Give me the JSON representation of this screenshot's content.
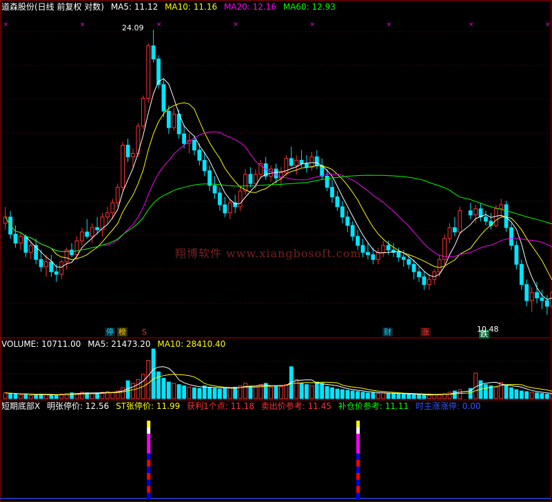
{
  "header_main": {
    "name": "道森股份(日线 前复权 对数)",
    "ma5": "MA5: 11.12",
    "ma10": "MA10: 11.16",
    "ma20": "MA20: 12.16",
    "ma60": "MA60: 12.93"
  },
  "header_volume": {
    "vol": "VOLUME: 10711.00",
    "ma5": "MA5: 21473.20",
    "ma10": "MA10: 28410.40"
  },
  "header_indicator": {
    "title": "短期底部X",
    "ming": "明张停价: 12.56",
    "st": "ST张停价: 11.99",
    "profit": "获利1个点: 11.18",
    "sell": "卖出价参考: 11.45",
    "buy": "补仓价参考: 11.11",
    "boss": "时主涨涨停: 0.00"
  },
  "watermark": "翔博软件 www.xiangbosoft.com",
  "annotations": {
    "high_label": "24.09",
    "low_label": "10.48",
    "badge_ting": "停",
    "badge_bang": "榜",
    "badge_s": "S",
    "badge_cai": "财",
    "badge_zhang": "涨",
    "badge_die": "跌"
  },
  "colors": {
    "up": "#ff3333",
    "down": "#00e5ff",
    "ma5": "#ffffff",
    "ma10": "#ffff00",
    "ma20": "#ff00ff",
    "ma60": "#00ff00"
  },
  "chart_data": {
    "type": "candlestick",
    "scale": "log",
    "price_range": [
      9.8,
      27.0
    ],
    "candles": [
      [
        14.0,
        14.8,
        13.7,
        14.3
      ],
      [
        14.3,
        14.6,
        13.3,
        13.5
      ],
      [
        13.5,
        13.9,
        12.9,
        13.1
      ],
      [
        13.1,
        13.6,
        12.8,
        13.4
      ],
      [
        13.4,
        13.5,
        12.5,
        12.7
      ],
      [
        12.7,
        13.2,
        12.4,
        13.0
      ],
      [
        13.0,
        13.3,
        12.2,
        12.4
      ],
      [
        12.4,
        12.8,
        11.9,
        12.1
      ],
      [
        12.1,
        12.6,
        11.7,
        12.3
      ],
      [
        12.3,
        12.6,
        11.7,
        11.9
      ],
      [
        11.9,
        12.2,
        11.5,
        11.8
      ],
      [
        11.8,
        12.4,
        11.6,
        12.3
      ],
      [
        12.3,
        12.9,
        12.0,
        12.8
      ],
      [
        12.8,
        13.1,
        12.5,
        12.6
      ],
      [
        12.6,
        13.4,
        12.4,
        13.2
      ],
      [
        13.2,
        13.8,
        13.0,
        13.6
      ],
      [
        13.6,
        14.2,
        13.3,
        13.4
      ],
      [
        13.4,
        14.0,
        13.1,
        13.8
      ],
      [
        13.8,
        14.3,
        13.5,
        13.7
      ],
      [
        13.7,
        14.5,
        13.4,
        14.3
      ],
      [
        14.3,
        14.8,
        14.0,
        14.5
      ],
      [
        14.5,
        15.2,
        14.2,
        15.0
      ],
      [
        15.0,
        16.0,
        14.8,
        15.8
      ],
      [
        15.8,
        18.4,
        15.6,
        18.2
      ],
      [
        18.2,
        18.6,
        17.2,
        17.5
      ],
      [
        17.5,
        18.0,
        16.9,
        17.7
      ],
      [
        17.7,
        19.6,
        17.5,
        19.4
      ],
      [
        19.4,
        21.5,
        19.2,
        21.3
      ],
      [
        21.3,
        25.6,
        21.0,
        25.4
      ],
      [
        25.4,
        26.8,
        24.0,
        24.3
      ],
      [
        24.3,
        24.6,
        22.0,
        22.3
      ],
      [
        22.3,
        22.8,
        20.0,
        20.4
      ],
      [
        20.4,
        20.8,
        18.9,
        19.3
      ],
      [
        19.3,
        20.6,
        19.1,
        20.2
      ],
      [
        20.2,
        20.5,
        18.6,
        18.9
      ],
      [
        18.9,
        19.5,
        18.0,
        18.3
      ],
      [
        18.3,
        18.9,
        17.7,
        18.5
      ],
      [
        18.5,
        18.8,
        17.6,
        17.9
      ],
      [
        17.9,
        18.3,
        17.0,
        17.3
      ],
      [
        17.3,
        17.8,
        16.4,
        16.7
      ],
      [
        16.7,
        17.0,
        15.6,
        15.9
      ],
      [
        15.9,
        16.4,
        15.2,
        15.5
      ],
      [
        15.5,
        15.8,
        14.6,
        14.9
      ],
      [
        14.9,
        15.3,
        14.3,
        14.5
      ],
      [
        14.5,
        15.2,
        14.2,
        15.0
      ],
      [
        15.0,
        15.4,
        14.5,
        14.8
      ],
      [
        14.8,
        15.9,
        14.6,
        15.6
      ],
      [
        15.6,
        16.8,
        15.4,
        16.5
      ],
      [
        16.5,
        16.9,
        15.8,
        16.0
      ],
      [
        16.0,
        16.8,
        15.7,
        16.5
      ],
      [
        16.5,
        17.3,
        16.3,
        17.1
      ],
      [
        17.1,
        17.5,
        16.2,
        16.4
      ],
      [
        16.4,
        17.0,
        16.1,
        16.8
      ],
      [
        16.8,
        17.1,
        16.0,
        16.3
      ],
      [
        16.3,
        16.9,
        15.8,
        16.6
      ],
      [
        16.6,
        17.6,
        16.4,
        17.4
      ],
      [
        17.4,
        18.1,
        16.9,
        17.0
      ],
      [
        17.0,
        17.6,
        16.5,
        17.3
      ],
      [
        17.3,
        17.9,
        16.9,
        17.1
      ],
      [
        17.1,
        17.6,
        16.6,
        16.9
      ],
      [
        16.9,
        17.8,
        16.7,
        17.5
      ],
      [
        17.5,
        17.9,
        16.8,
        17.0
      ],
      [
        17.0,
        17.4,
        16.2,
        16.4
      ],
      [
        16.4,
        16.8,
        15.6,
        15.8
      ],
      [
        15.8,
        16.2,
        15.0,
        15.3
      ],
      [
        15.3,
        15.6,
        14.6,
        14.8
      ],
      [
        14.8,
        15.1,
        14.0,
        14.3
      ],
      [
        14.3,
        14.6,
        13.6,
        13.9
      ],
      [
        13.9,
        14.1,
        13.2,
        13.4
      ],
      [
        13.4,
        13.7,
        12.8,
        13.0
      ],
      [
        13.0,
        13.3,
        12.5,
        12.7
      ],
      [
        12.7,
        13.1,
        12.4,
        12.6
      ],
      [
        12.6,
        12.9,
        12.2,
        12.4
      ],
      [
        12.4,
        12.9,
        12.2,
        12.7
      ],
      [
        12.7,
        13.2,
        12.5,
        13.0
      ],
      [
        13.0,
        13.2,
        12.6,
        12.8
      ],
      [
        12.8,
        13.1,
        12.5,
        12.7
      ],
      [
        12.7,
        12.9,
        12.3,
        12.5
      ],
      [
        12.5,
        12.8,
        12.1,
        12.4
      ],
      [
        12.4,
        12.6,
        12.0,
        12.2
      ],
      [
        12.2,
        12.4,
        11.6,
        11.9
      ],
      [
        11.9,
        12.1,
        11.5,
        11.7
      ],
      [
        11.7,
        11.9,
        11.2,
        11.4
      ],
      [
        11.4,
        11.8,
        11.2,
        11.6
      ],
      [
        11.6,
        12.0,
        11.4,
        11.9
      ],
      [
        11.9,
        12.6,
        11.7,
        12.4
      ],
      [
        12.4,
        13.5,
        12.2,
        13.3
      ],
      [
        13.3,
        14.0,
        13.1,
        13.8
      ],
      [
        13.8,
        14.3,
        13.4,
        13.6
      ],
      [
        13.6,
        14.8,
        13.5,
        14.6
      ],
      [
        14.6,
        15.0,
        14.2,
        14.4
      ],
      [
        14.4,
        14.9,
        14.0,
        14.7
      ],
      [
        14.7,
        15.0,
        14.1,
        14.3
      ],
      [
        14.3,
        14.6,
        13.9,
        14.1
      ],
      [
        14.1,
        14.5,
        13.7,
        13.9
      ],
      [
        13.9,
        14.9,
        13.8,
        14.7
      ],
      [
        14.7,
        15.2,
        14.3,
        14.9
      ],
      [
        14.9,
        15.1,
        13.6,
        13.8
      ],
      [
        13.8,
        14.0,
        12.8,
        13.0
      ],
      [
        13.0,
        13.2,
        12.0,
        12.2
      ],
      [
        12.2,
        12.4,
        11.2,
        11.4
      ],
      [
        11.4,
        11.6,
        10.6,
        10.8
      ],
      [
        10.8,
        11.3,
        10.4,
        11.1
      ],
      [
        11.1,
        11.5,
        10.7,
        10.9
      ],
      [
        10.9,
        11.2,
        10.5,
        10.8
      ],
      [
        10.8,
        11.0,
        10.3,
        10.6
      ],
      [
        10.6,
        11.2,
        10.5,
        11.1
      ]
    ],
    "gap_at": 90,
    "volume": [
      9,
      8,
      7,
      6,
      7,
      5,
      6,
      7,
      6,
      5,
      6,
      7,
      8,
      9,
      8,
      10,
      9,
      8,
      9,
      10,
      11,
      10,
      12,
      17,
      28,
      24,
      30,
      38,
      60,
      78,
      42,
      32,
      26,
      24,
      22,
      20,
      18,
      17,
      16,
      20,
      18,
      16,
      15,
      16,
      17,
      18,
      20,
      24,
      19,
      18,
      22,
      24,
      18,
      20,
      19,
      22,
      50,
      30,
      24,
      22,
      20,
      26,
      24,
      19,
      17,
      15,
      14,
      13,
      12,
      11,
      10,
      9,
      9,
      8,
      9,
      8,
      8,
      7,
      7,
      7,
      6,
      6,
      6,
      5,
      6,
      7,
      8,
      10,
      12,
      14,
      16,
      40,
      28,
      22,
      20,
      18,
      25,
      22,
      17,
      14,
      12,
      11,
      10,
      9,
      8,
      7,
      6,
      6,
      5
    ]
  }
}
